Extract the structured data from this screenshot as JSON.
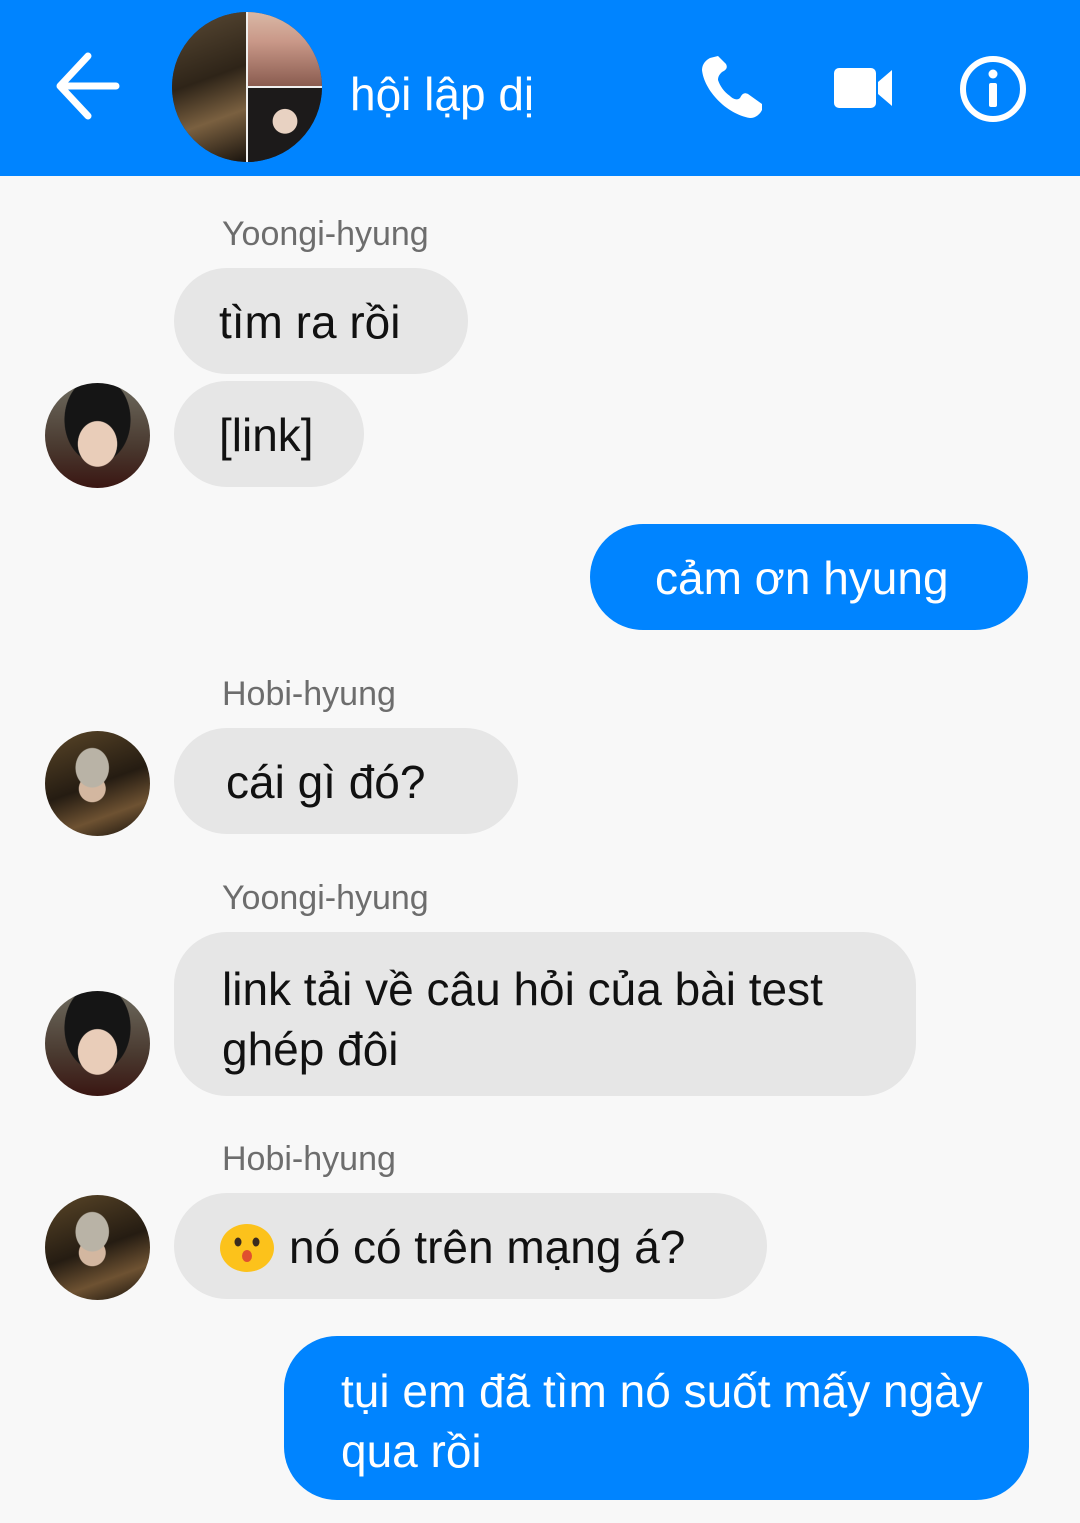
{
  "header": {
    "title": "hội lập dị",
    "back_icon": "arrow-left-icon",
    "call_icon": "phone-icon",
    "video_icon": "video-camera-icon",
    "info_icon": "info-icon",
    "bg_color": "#0084ff"
  },
  "messages": [
    {
      "sender": "Yoongi-hyung"
    },
    {
      "text": "tìm ra rồi"
    },
    {
      "text": "[link]"
    },
    {
      "text": "cảm ơn hyung"
    },
    {
      "sender": "Hobi-hyung"
    },
    {
      "text": "cái gì đó?"
    },
    {
      "sender": "Yoongi-hyung"
    },
    {
      "text": "link tải về câu hỏi của bài test ghép đôi"
    },
    {
      "sender": "Hobi-hyung"
    },
    {
      "text": "nó có trên mạng á?",
      "emoji": "hushed-face-emoji"
    },
    {
      "text": "tụi em đã tìm nó suốt mấy ngày qua rồi"
    }
  ],
  "colors": {
    "outgoing_bubble": "#0084ff",
    "incoming_bubble": "#e6e6e6",
    "background": "#f8f8f8"
  }
}
